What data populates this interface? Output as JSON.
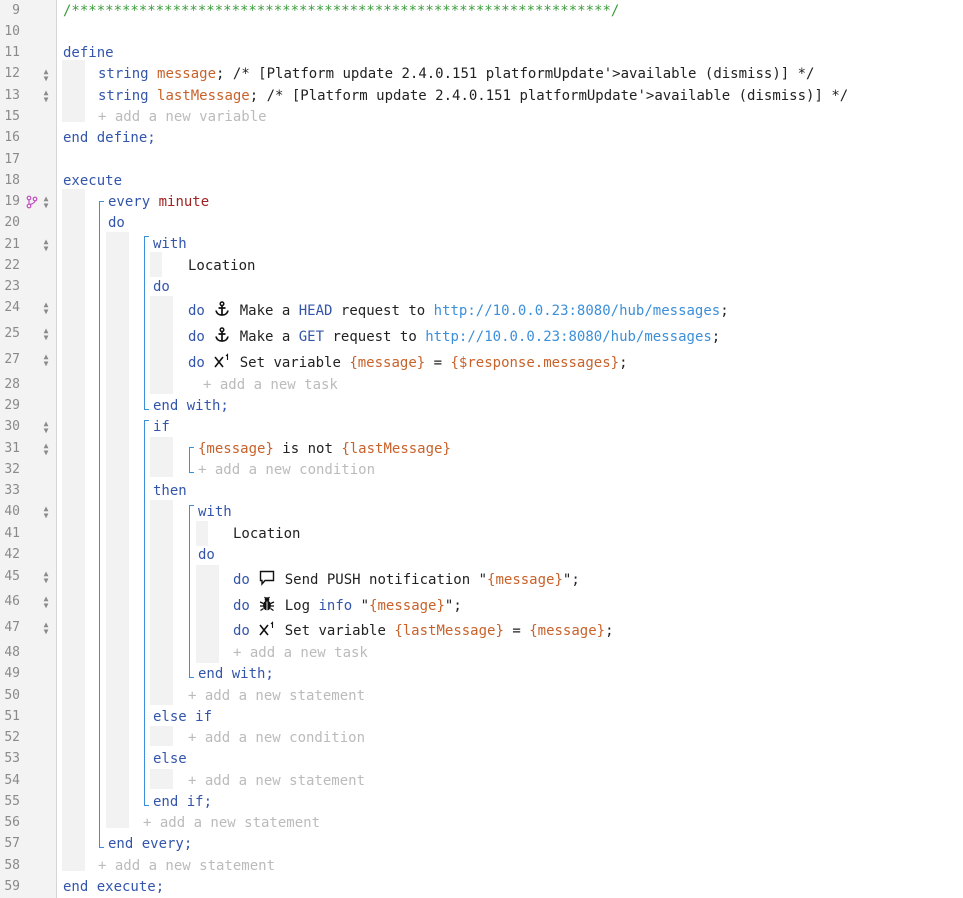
{
  "gutter": {
    "line_numbers": [
      "9",
      "10",
      "11",
      "12",
      "13",
      "15",
      "16",
      "17",
      "18",
      "19",
      "20",
      "21",
      "22",
      "23",
      "24",
      "25",
      "27",
      "28",
      "29",
      "30",
      "31",
      "32",
      "33",
      "40",
      "41",
      "42",
      "45",
      "46",
      "47",
      "48",
      "49",
      "50",
      "51",
      "52",
      "53",
      "54",
      "55",
      "56",
      "57",
      "58",
      "59"
    ]
  },
  "code": {
    "header_comment": "/****************************************************************/",
    "define": "define",
    "var1_type": "string",
    "var1_name": "message",
    "var1_comment": "; /* [Platform update 2.4.0.151 platformUpdate'>available (dismiss)] */",
    "var2_type": "string",
    "var2_name": "lastMessage",
    "var2_comment": "; /* [Platform update 2.4.0.151 platformUpdate'>available (dismiss)] */",
    "add_variable": "+ add a new variable",
    "end_define": "end define;",
    "execute": "execute",
    "every": "every",
    "minute": "minute",
    "do": "do",
    "with": "with",
    "location": "Location",
    "task1_action": "Make a",
    "task1_method": "HEAD",
    "task1_mid": "request to",
    "task1_url": "http://10.0.0.23:8080/hub/messages",
    "task2_action": "Make a",
    "task2_method": "GET",
    "task2_mid": "request to",
    "task2_url": "http://10.0.0.23:8080/hub/messages",
    "task3_action": "Set variable",
    "task3_var": "{message}",
    "task3_eq": "=",
    "task3_value": "{$response.messages}",
    "add_task": "+ add a new task",
    "end_with": "end with;",
    "if": "if",
    "cond_left": "{message}",
    "cond_op": "is not",
    "cond_right": "{lastMessage}",
    "add_condition": "+ add a new condition",
    "then": "then",
    "task4_action": "Send PUSH notification",
    "task4_value": "{message}",
    "task5_action": "Log",
    "task5_level": "info",
    "task5_value": "{message}",
    "task6_action": "Set variable",
    "task6_var": "{lastMessage}",
    "task6_eq": "=",
    "task6_value": "{message}",
    "add_statement": "+ add a new statement",
    "else_if": "else if",
    "else": "else",
    "end_if": "end if;",
    "end_every": "end every;",
    "end_execute": "end execute;"
  },
  "icons": {
    "anchor": "anchor-icon",
    "variable": "variable-x1-icon",
    "chat": "speech-bubble-icon",
    "bug": "bug-icon",
    "branch": "branch-icon",
    "move": "move-up-down-icon"
  },
  "colors": {
    "keyword": "#3355aa",
    "variable": "#c8622b",
    "url": "#3c8fd9",
    "comment_header": "#3b9c3b",
    "trigger": "#a12222",
    "placeholder": "#bbbbbb",
    "gutter_bg": "#f3f3f3"
  }
}
